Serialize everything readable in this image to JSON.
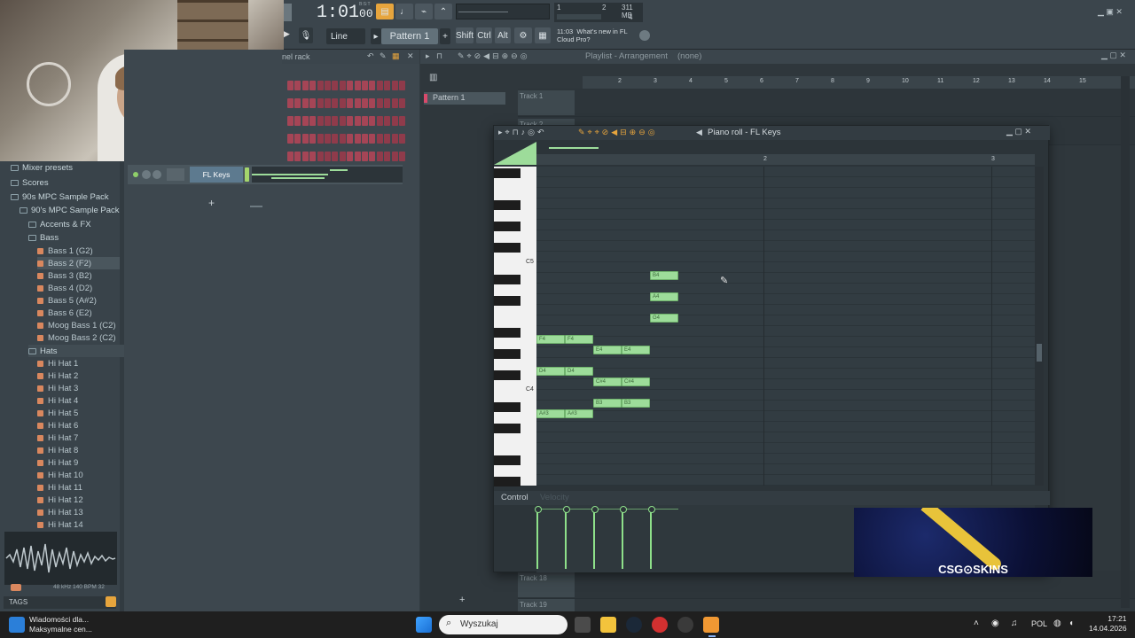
{
  "toolbar": {
    "time": "1:01",
    "time_sub": "00",
    "bst": "B:S:T",
    "pattern": "Pattern 1",
    "line": "Line",
    "shift": "Shift",
    "ctrl": "Ctrl",
    "alt": "Alt",
    "cpu_num": "1",
    "cpu_poly": "2",
    "mem": "311 MB",
    "mem2": "4",
    "news_time": "11:03",
    "news_text": "What's new in FL",
    "news_text2": "Cloud Pro?"
  },
  "browser": {
    "mixer_presets": "Mixer presets",
    "scores": "Scores",
    "pack1": "90s MPC Sample Pack",
    "pack2": "90's MPC Sample Pack",
    "accents": "Accents & FX",
    "bass": "Bass",
    "bass_items": [
      "Bass 1 (G2)",
      "Bass 2 (F2)",
      "Bass 3 (B2)",
      "Bass 4 (D2)",
      "Bass 5 (A#2)",
      "Bass 6 (E2)",
      "Moog Bass 1 (C2)",
      "Moog Bass 2 (C2)"
    ],
    "hats": "Hats",
    "hat_items": [
      "Hi Hat 1",
      "Hi Hat 2",
      "Hi Hat 3",
      "Hi Hat 4",
      "Hi Hat 5",
      "Hi Hat 6",
      "Hi Hat 7",
      "Hi Hat 8",
      "Hi Hat 9",
      "Hi Hat 10",
      "Hi Hat 11",
      "Hi Hat 12",
      "Hi Hat 13",
      "Hi Hat 14"
    ],
    "sample_info": "48 kHz 140 BPM 32",
    "tags": "TAGS"
  },
  "channel_rack": {
    "title": "nel rack",
    "channel_name": "FL Keys",
    "add": "+"
  },
  "playlist": {
    "title": "Playlist - Arrangement",
    "none": "(none)",
    "pattern_item": "Pattern 1",
    "ruler": [
      "2",
      "3",
      "4",
      "5",
      "6",
      "7",
      "8",
      "9",
      "10",
      "11",
      "12",
      "13",
      "14",
      "15"
    ],
    "tracks": [
      "Track 1",
      "Track 2",
      "Track 18",
      "Track 19"
    ],
    "add": "+"
  },
  "piano_roll": {
    "title": "Piano roll - FL Keys",
    "bar2": "2",
    "bar3": "3",
    "key_c5": "C5",
    "key_c4": "C4",
    "control_label": "Control",
    "control_sub": "Velocity",
    "notes": [
      {
        "label": "B4"
      },
      {
        "label": "A4"
      },
      {
        "label": "G4"
      },
      {
        "label": "F4"
      },
      {
        "label": "F4"
      },
      {
        "label": "E4"
      },
      {
        "label": "E4"
      },
      {
        "label": "D4"
      },
      {
        "label": "D4"
      },
      {
        "label": "C#4"
      },
      {
        "label": "C#4"
      },
      {
        "label": "B3"
      },
      {
        "label": "B3"
      },
      {
        "label": "A#3"
      },
      {
        "label": "A#3"
      }
    ]
  },
  "ad": {
    "brand": "CSG⊙SKINS"
  },
  "taskbar": {
    "news_title": "Wiadomości dla...",
    "news_sub": "Maksymalne cen...",
    "search_placeholder": "Wyszukaj",
    "lang": "POL",
    "time": "17:21",
    "date": "14.04.2026"
  }
}
